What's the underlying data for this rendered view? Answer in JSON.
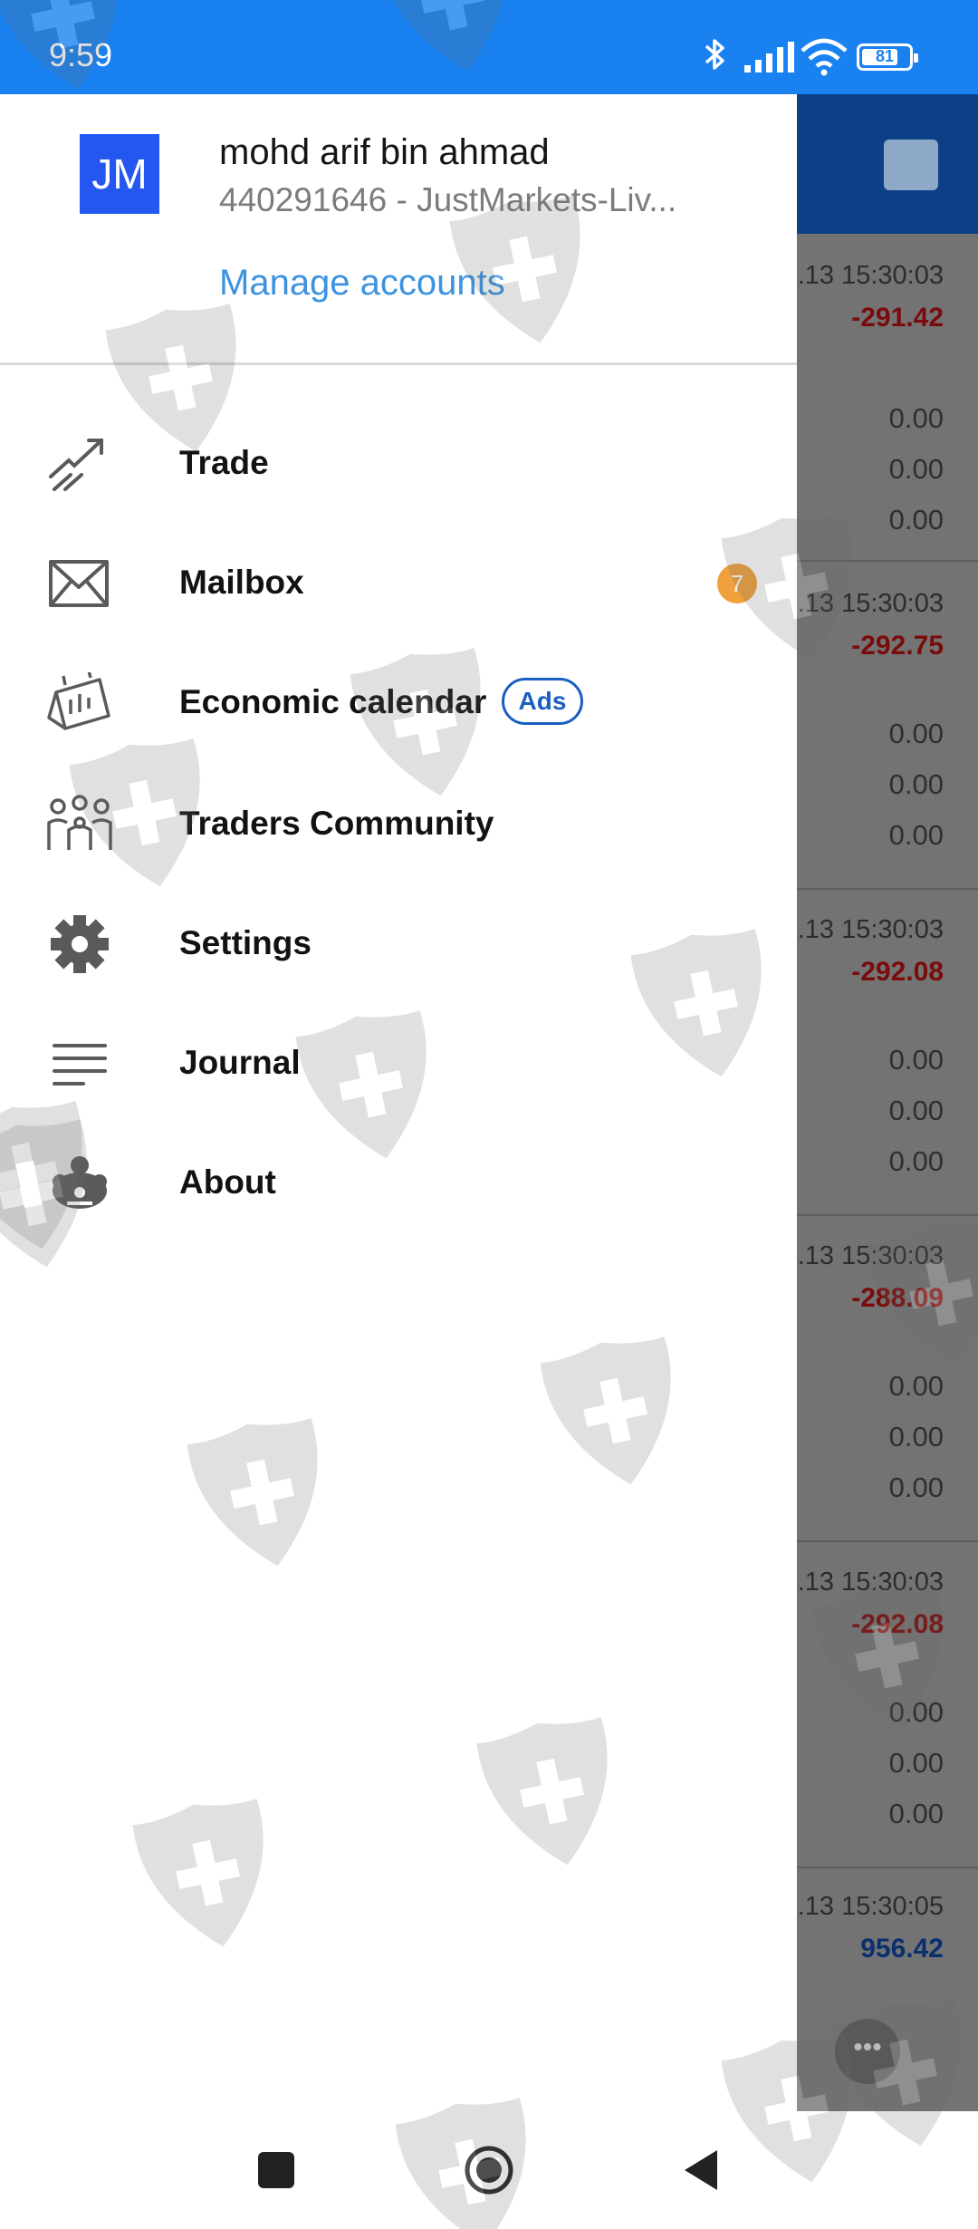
{
  "status_bar": {
    "time": "9:59",
    "battery_level": "81",
    "battery_fraction": 0.81,
    "icons": [
      "bluetooth-icon",
      "signal-icon",
      "wifi-icon",
      "battery-icon"
    ]
  },
  "account": {
    "initials": "JM",
    "name": "mohd arif bin ahmad",
    "id_server": "440291646 - JustMarkets-Liv...",
    "manage_label": "Manage accounts",
    "avatar_color": "#2457ef",
    "link_color": "#3c93e0"
  },
  "menu": {
    "items": [
      {
        "label": "Trade",
        "icon": "trade-chart-icon"
      },
      {
        "label": "Mailbox",
        "icon": "envelope-icon",
        "badge": "7"
      },
      {
        "label": "Economic calendar",
        "icon": "calendar-icon",
        "tag": "Ads"
      },
      {
        "label": "Traders Community",
        "icon": "community-icon"
      },
      {
        "label": "Settings",
        "icon": "gear-icon"
      },
      {
        "label": "Journal",
        "icon": "journal-lines-icon"
      },
      {
        "label": "About",
        "icon": "about-logo-icon"
      }
    ]
  },
  "background_list": {
    "rows": [
      {
        "time": ".13 15:30:03",
        "profit": "-291.42",
        "zeros": []
      },
      {
        "time": "",
        "profit": "",
        "zeros": [
          "0.00",
          "0.00",
          "0.00"
        ]
      },
      {
        "time": ".13 15:30:03",
        "profit": "-292.75",
        "zeros": [
          "0.00",
          "0.00",
          "0.00"
        ]
      },
      {
        "time": ".13 15:30:03",
        "profit": "-292.08",
        "zeros": [
          "0.00",
          "0.00",
          "0.00"
        ]
      },
      {
        "time": ".13 15:30:03",
        "profit": "-288.09",
        "zeros": [
          "0.00",
          "0.00",
          "0.00"
        ]
      },
      {
        "time": ".13 15:30:03",
        "profit": "-292.08",
        "zeros": [
          "0.00",
          "0.00",
          "0.00"
        ]
      },
      {
        "time": ".13 15:30:05",
        "profit": "956.42",
        "zeros": []
      }
    ],
    "loss_color": "#7a0b0b",
    "gain_color": "#0b2f6e"
  },
  "nav_bar": {
    "icons": [
      "recents-square-icon",
      "home-circle-icon",
      "back-triangle-icon"
    ]
  }
}
